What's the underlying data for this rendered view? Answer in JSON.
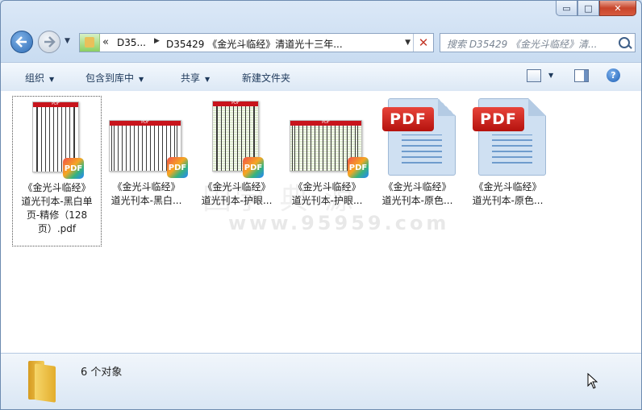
{
  "window": {
    "minimize_glyph": "▭",
    "maximize_glyph": "□",
    "close_glyph": "✕"
  },
  "address_bar": {
    "chevron": "«",
    "segment1": "D35...",
    "segment_arrow": "▶",
    "segment2": "D35429 《金光斗临经》清道光十三年...",
    "dropdown_glyph": "▼",
    "clear_glyph": "✕"
  },
  "search": {
    "placeholder": "搜索 D35429 《金光斗临经》清..."
  },
  "toolbar": {
    "organize": "组织",
    "include_in_library": "包含到库中",
    "share": "共享",
    "new_folder": "新建文件夹",
    "help_glyph": "?"
  },
  "watermark": {
    "line1": "国学  典  源",
    "line2": "www.95959.com"
  },
  "files": [
    {
      "name": "《金光斗临经》道光刊本-黑白单页-精修（128页）.pdf",
      "label_lines": [
        "《金光斗临经》",
        "道光刊本-黑白单",
        "页-精修（128",
        "页）.pdf"
      ],
      "thumb": "portrait-bw",
      "badge": "PDF",
      "selected": true
    },
    {
      "name": "《金光斗临经》道光刊本-黑白...",
      "label_lines": [
        "《金光斗临经》",
        "道光刊本-黑白..."
      ],
      "thumb": "landscape-bw",
      "badge": "PDF",
      "selected": false
    },
    {
      "name": "《金光斗临经》道光刊本-护眼...",
      "label_lines": [
        "《金光斗临经》",
        "道光刊本-护眼..."
      ],
      "thumb": "portrait-green",
      "badge": "PDF",
      "selected": false
    },
    {
      "name": "《金光斗临经》道光刊本-护眼...",
      "label_lines": [
        "《金光斗临经》",
        "道光刊本-护眼..."
      ],
      "thumb": "landscape-green",
      "badge": "PDF",
      "selected": false
    },
    {
      "name": "《金光斗临经》道光刊本-原色...",
      "label_lines": [
        "《金光斗临经》",
        "道光刊本-原色..."
      ],
      "thumb": "pdf-icon",
      "badge": "PDF",
      "selected": false
    },
    {
      "name": "《金光斗临经》道光刊本-原色...",
      "label_lines": [
        "《金光斗临经》",
        "道光刊本-原色..."
      ],
      "thumb": "pdf-icon",
      "badge": "PDF",
      "selected": false
    }
  ],
  "thumb_bar_label": "PDF",
  "details": {
    "count_text": "6 个对象"
  },
  "colors": {
    "accent": "#1e395b",
    "pdf_red": "#c8141c",
    "selection_border": "#555555"
  }
}
